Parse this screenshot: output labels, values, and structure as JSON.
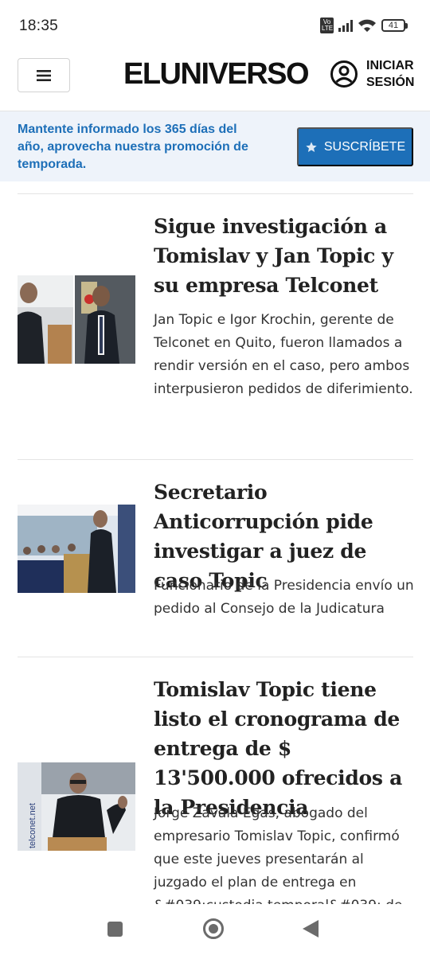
{
  "status_bar": {
    "time": "18:35",
    "volte": "Vo LTE",
    "battery": "41"
  },
  "header": {
    "menu_icon": "hamburger-icon",
    "logo": "ELUNIVERSO",
    "login_line1": "INICIAR",
    "login_line2": "SESIÓN",
    "account_icon": "user-circle-icon"
  },
  "promo": {
    "text": "Mantente informado los 365 días del año, aprovecha nuestra promoción de temporada.",
    "button_label": "SUSCRÍBETE",
    "button_icon": "star-icon",
    "accent_color": "#1d6fb8",
    "background_color": "#eef3fa"
  },
  "articles": [
    {
      "headline": "Sigue investigación a Tomislav y Jan Topic y su empresa Telconet",
      "summary": "Jan Topic e Igor Krochin, gerente de Telconet en Quito, fueron llamados a rendir versión en el caso, pero ambos interpusieron pedidos de diferimiento."
    },
    {
      "headline": "Secretario Anticorrupción pide investigar a juez de caso Topic",
      "summary": "Funcionario de la Presidencia envío un pedido al Consejo de la Judicatura"
    },
    {
      "headline": "Tomislav Topic tiene listo el cronograma de entrega de $ 13'500.000 ofrecidos a la Presidencia",
      "summary": "Jorge Zavala Egas, abogado del empresario Tomislav Topic, confirmó que este jueves presentarán al juzgado el plan de entrega en &#039;custodia temporal&#039; de",
      "image_text": "telconet.net"
    }
  ],
  "navbar": {
    "recents_icon": "square-icon",
    "home_icon": "home-circle-icon",
    "back_icon": "back-triangle-icon"
  }
}
